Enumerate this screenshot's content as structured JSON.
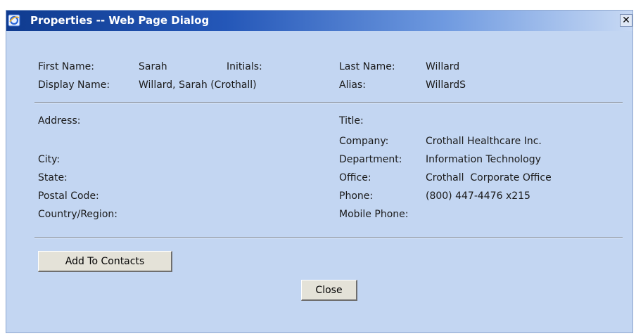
{
  "window": {
    "title": "Properties -- Web Page Dialog",
    "close_glyph": "✕"
  },
  "fields": {
    "first_name": {
      "label": "First Name:",
      "value": "Sarah"
    },
    "initials": {
      "label": "Initials:",
      "value": ""
    },
    "last_name": {
      "label": "Last Name:",
      "value": "Willard"
    },
    "display_name": {
      "label": "Display Name:",
      "value": "Willard, Sarah (Crothall)"
    },
    "alias": {
      "label": "Alias:",
      "value": "WillardS"
    },
    "address": {
      "label": "Address:",
      "value": ""
    },
    "title": {
      "label": "Title:",
      "value": ""
    },
    "company": {
      "label": "Company:",
      "value": "Crothall Healthcare Inc."
    },
    "city": {
      "label": "City:",
      "value": ""
    },
    "department": {
      "label": "Department:",
      "value": "Information Technology"
    },
    "state": {
      "label": "State:",
      "value": ""
    },
    "office": {
      "label": "Office:",
      "value": "Crothall  Corporate Office"
    },
    "postal_code": {
      "label": "Postal Code:",
      "value": ""
    },
    "phone": {
      "label": "Phone:",
      "value": "(800) 447-4476 x215"
    },
    "country": {
      "label": "Country/Region:",
      "value": ""
    },
    "mobile_phone": {
      "label": "Mobile Phone:",
      "value": ""
    }
  },
  "buttons": {
    "add_to_contacts": "Add To Contacts",
    "close": "Close"
  },
  "icons": {
    "app": "ie-icon",
    "close": "close-icon"
  },
  "colors": {
    "dialog_bg": "#c3d6f2",
    "titlebar": "#0f3b8f",
    "button_bg": "#e4e2d8"
  }
}
